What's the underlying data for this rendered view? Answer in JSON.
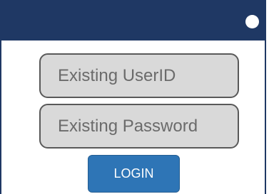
{
  "login_form": {
    "userid_placeholder": "Existing UserID",
    "password_placeholder": "Existing Password",
    "login_label": "LOGIN"
  },
  "colors": {
    "titlebar": "#1f3864",
    "field_background": "#d9d9d9",
    "field_border": "#595959",
    "field_text": "#6b6b6b",
    "button_background": "#2e75b6",
    "button_text": "#ffffff"
  }
}
